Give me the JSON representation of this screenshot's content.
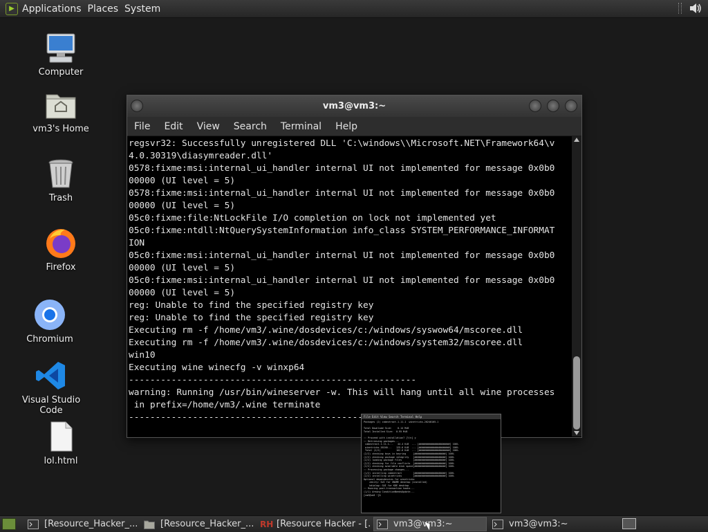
{
  "top_panel": {
    "menu": [
      "Applications",
      "Places",
      "System"
    ]
  },
  "desktop": {
    "icons": [
      {
        "label": "Computer",
        "icon": "computer-icon"
      },
      {
        "label": "vm3's Home",
        "icon": "home-folder-icon"
      },
      {
        "label": "Trash",
        "icon": "trash-icon"
      },
      {
        "label": "Firefox",
        "icon": "firefox-icon"
      },
      {
        "label": "Chromium",
        "icon": "chromium-icon"
      },
      {
        "label": "Visual Studio Code",
        "icon": "vscode-icon"
      },
      {
        "label": "lol.html",
        "icon": "file-icon"
      }
    ]
  },
  "terminal": {
    "title": "vm3@vm3:~",
    "menu": [
      "File",
      "Edit",
      "View",
      "Search",
      "Terminal",
      "Help"
    ],
    "lines": [
      "regsvr32: Successfully unregistered DLL 'C:\\windows\\\\Microsoft.NET\\Framework64\\v",
      "4.0.30319\\diasymreader.dll'",
      "0578:fixme:msi:internal_ui_handler internal UI not implemented for message 0x0b0",
      "00000 (UI level = 5)",
      "0578:fixme:msi:internal_ui_handler internal UI not implemented for message 0x0b0",
      "00000 (UI level = 5)",
      "05c0:fixme:file:NtLockFile I/O completion on lock not implemented yet",
      "05c0:fixme:ntdll:NtQuerySystemInformation info_class SYSTEM_PERFORMANCE_INFORMAT",
      "ION",
      "05c0:fixme:msi:internal_ui_handler internal UI not implemented for message 0x0b0",
      "00000 (UI level = 5)",
      "05c0:fixme:msi:internal_ui_handler internal UI not implemented for message 0x0b0",
      "00000 (UI level = 5)",
      "reg: Unable to find the specified registry key",
      "reg: Unable to find the specified registry key",
      "Executing rm -f /home/vm3/.wine/dosdevices/c:/windows/syswow64/mscoree.dll",
      "Executing rm -f /home/vm3/.wine/dosdevices/c:/windows/system32/mscoree.dll",
      "win10",
      "Executing wine winecfg -v winxp64",
      "------------------------------------------------------",
      "warning: Running /usr/bin/wineserver -w. This will hang until all wine processes",
      " in prefix=/home/vm3/.wine terminate",
      "------------------------------------------------------"
    ]
  },
  "preview": {
    "menu": "File  Edit  View  Search  Terminal  Help",
    "lines": [
      "Packages (2) cabextract-1.11-1  winetricks-20240105-1",
      "",
      "Total Download Size:    0.14 MiB",
      "Total Installed Size:  0.95 MiB",
      "",
      ":: Proceed with installation? [Y/n] y",
      ":: Retrieving packages...",
      " cabextract-1.11-1...   44.4 KiB  ... [######################] 100%",
      " winetricks-20240...   125.6 KiB  ... [######################] 100%",
      " Total (2/2)           162.6 KiB  ... [######################] 100%",
      "(2/2) checking keys in keyring     [######################] 100%",
      "(2/2) checking package integrity   [######################] 100%",
      "(2/2) loading package files        [######################] 100%",
      "(2/2) checking for file conflicts  [######################] 100%",
      "(2/2) checking available disk space[######################] 100%",
      ":: Processing package changes...",
      "(1/2) installing cabextract        [######################] 100%",
      "(2/2) installing winetricks        [######################] 100%",
      "Optional dependencies for winetricks",
      "    zenity: GUI for GNOME desktop (installed)",
      "    kdialog: GUI for KDE desktop",
      ":: Running post-transaction hooks...",
      "(1/1) Arming ConditionNeedsUpdate...",
      "[vm3@vm3 ~]$"
    ]
  },
  "taskbar": {
    "tasks": [
      {
        "label": "[Resource_Hacker_...",
        "icon": "terminal-icon",
        "active": false
      },
      {
        "label": "[Resource_Hacker_...",
        "icon": "folder-icon",
        "active": false
      },
      {
        "label": "[Resource Hacker - [...",
        "icon": "resource-hacker-icon",
        "active": false
      },
      {
        "label": "vm3@vm3:~",
        "icon": "terminal-icon",
        "active": true
      },
      {
        "label": "vm3@vm3:~",
        "icon": "terminal-icon",
        "active": false
      }
    ]
  }
}
